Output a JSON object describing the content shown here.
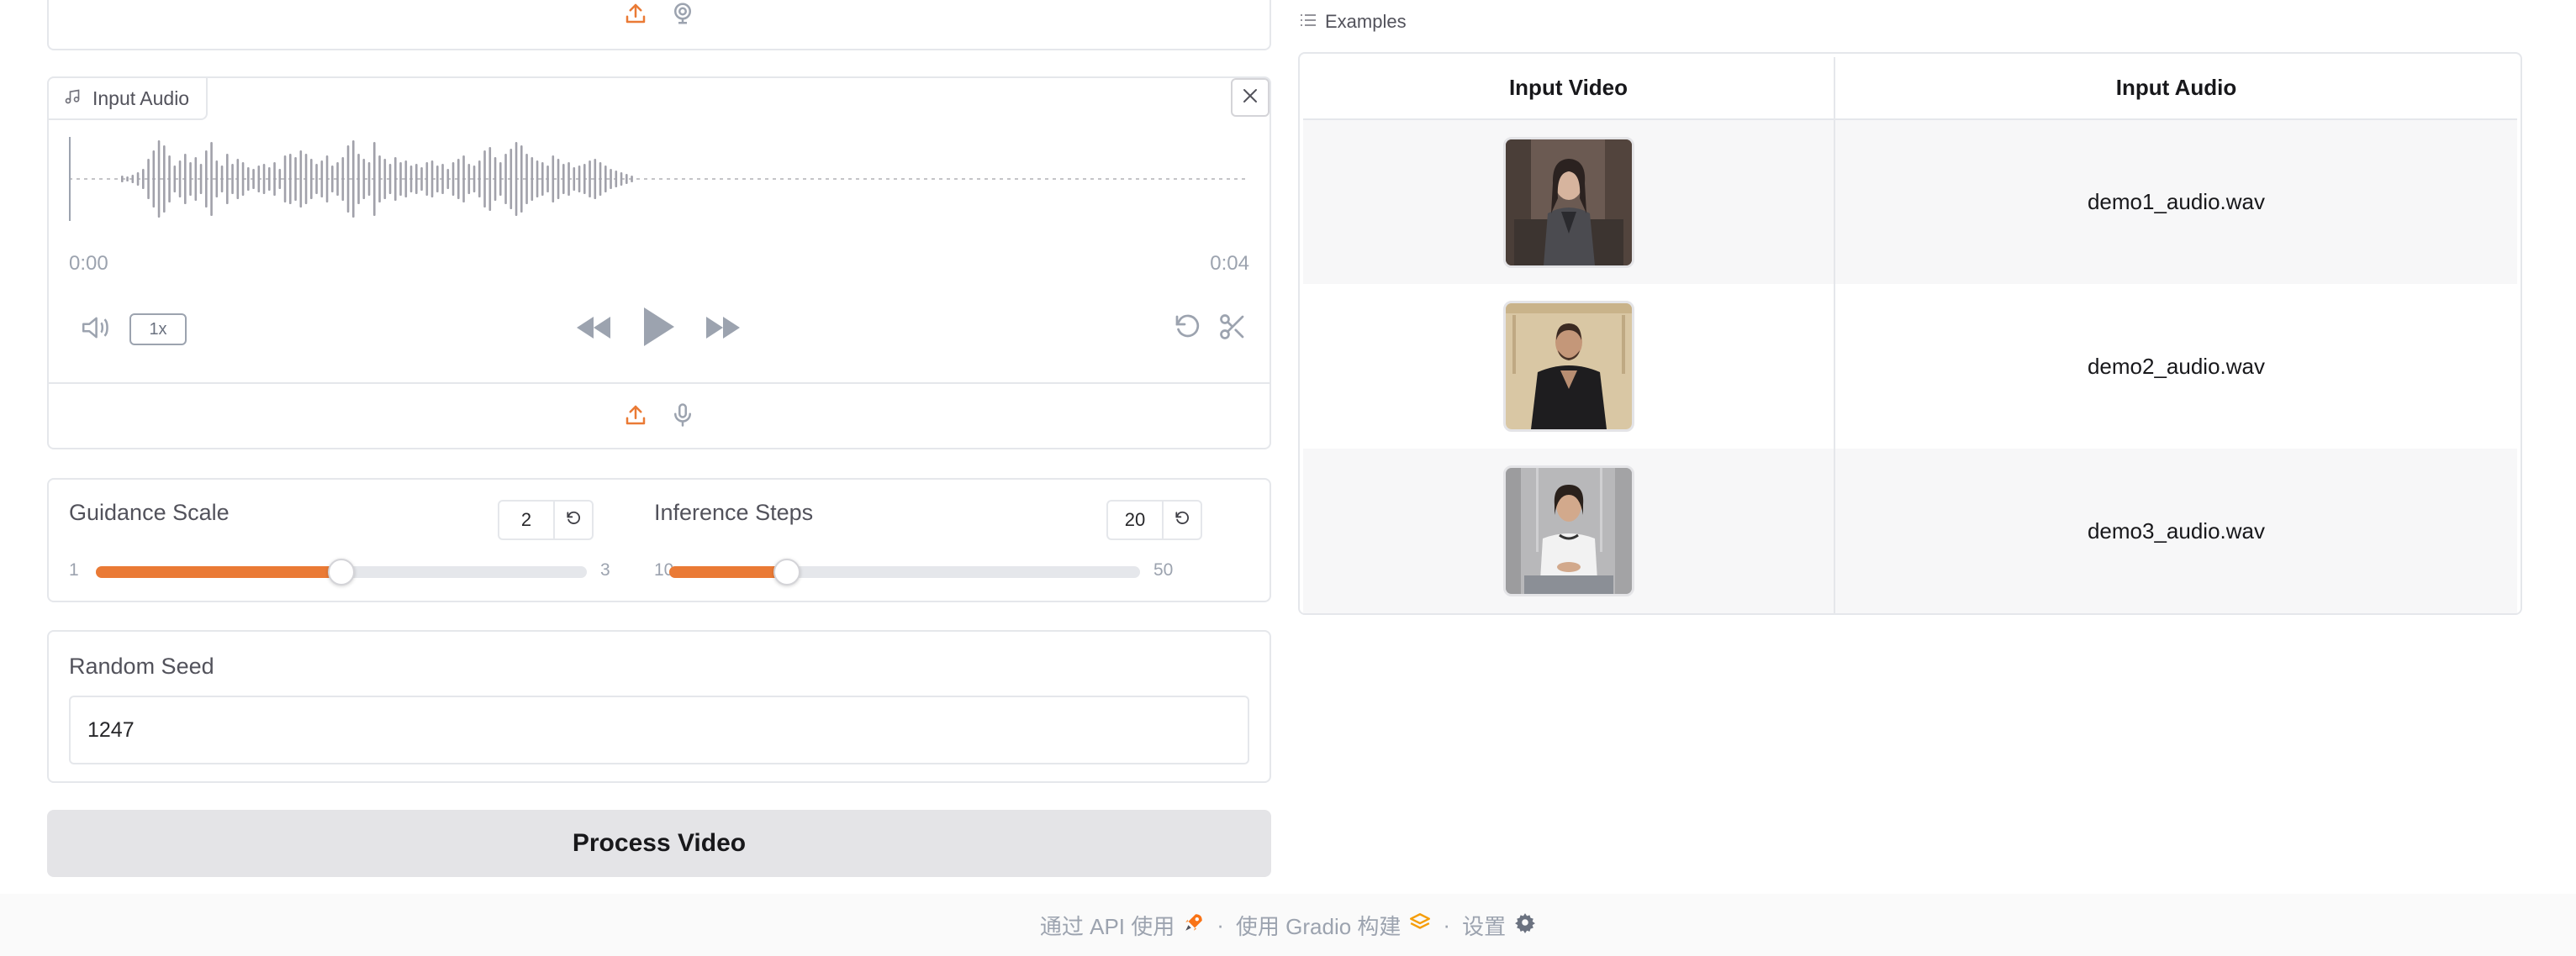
{
  "audio": {
    "label": "Input Audio",
    "time_start": "0:00",
    "time_end": "0:04",
    "speed": "1x",
    "accent": "#ea7a35"
  },
  "sliders": [
    {
      "label": "Guidance Scale",
      "value": "2",
      "min": "1",
      "max": "3",
      "fraction": 0.5
    },
    {
      "label": "Inference Steps",
      "value": "20",
      "min": "10",
      "max": "50",
      "fraction": 0.25
    }
  ],
  "seed": {
    "label": "Random Seed",
    "value": "1247"
  },
  "process_button": {
    "label": "Process Video",
    "background": "#e4e4e7"
  },
  "examples": {
    "label": "Examples",
    "headers": [
      "Input Video",
      "Input Audio"
    ],
    "rows": [
      {
        "audio": "demo1_audio.wav"
      },
      {
        "audio": "demo2_audio.wav"
      },
      {
        "audio": "demo3_audio.wav"
      }
    ]
  },
  "footer": {
    "api": "通过 API 使用",
    "built_with": "使用 Gradio 构建",
    "settings": "设置",
    "separator": "·"
  },
  "icons": [
    "upload-icon",
    "webcam-icon",
    "music-note-icon",
    "close-icon",
    "volume-icon",
    "rewind-icon",
    "play-icon",
    "fast-forward-icon",
    "undo-icon",
    "scissors-icon",
    "microphone-icon",
    "reset-icon",
    "list-icon",
    "rocket-icon",
    "gradio-logo-icon",
    "gear-icon"
  ]
}
